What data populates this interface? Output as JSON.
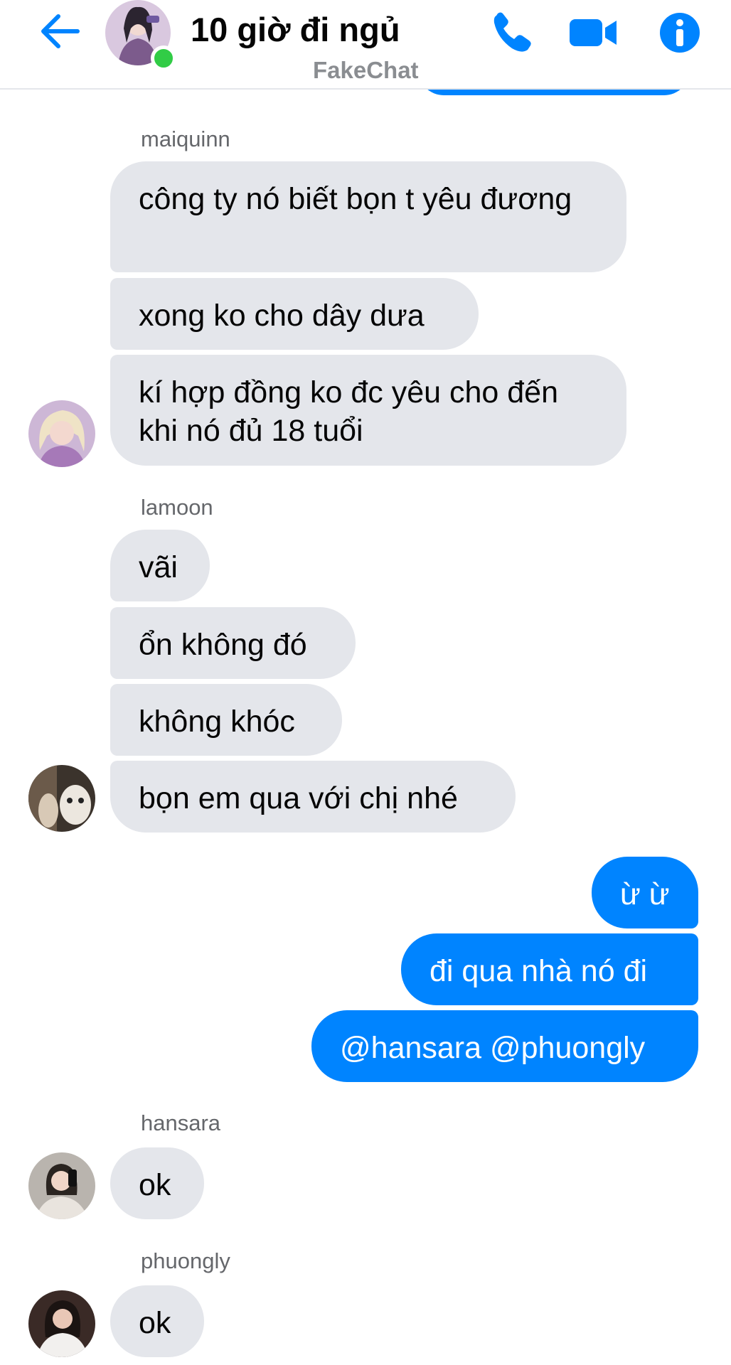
{
  "header": {
    "title": "10 giờ đi ngủ",
    "watermark": "FakeChat",
    "icons": {
      "back": "back-arrow-icon",
      "call": "phone-icon",
      "video": "video-camera-icon",
      "info": "info-icon"
    },
    "accent_color": "#0084ff",
    "online_color": "#31cc46"
  },
  "messages": {
    "g1": {
      "sender": "maiquinn",
      "m1": "công ty nó biết bọn t yêu đương",
      "m2": "xong ko cho dây dưa",
      "m3": "kí hợp đồng ko đc yêu cho đến khi nó đủ 18 tuổi"
    },
    "g2": {
      "sender": "lamoon",
      "m1": "vãi",
      "m2": "ổn không đó",
      "m3": "không khóc",
      "m4": "bọn em qua với chị nhé"
    },
    "mine": {
      "m1": "ừ ừ",
      "m2": "đi qua nhà nó đi",
      "m3": "@hansara @phuongly"
    },
    "g3": {
      "sender": "hansara",
      "m1": "ok"
    },
    "g4": {
      "sender": "phuongly",
      "m1": "ok"
    }
  },
  "colors": {
    "incoming_bubble": "#e4e6eb",
    "outgoing_bubble": "#0084ff",
    "sender_name": "#65676b"
  }
}
